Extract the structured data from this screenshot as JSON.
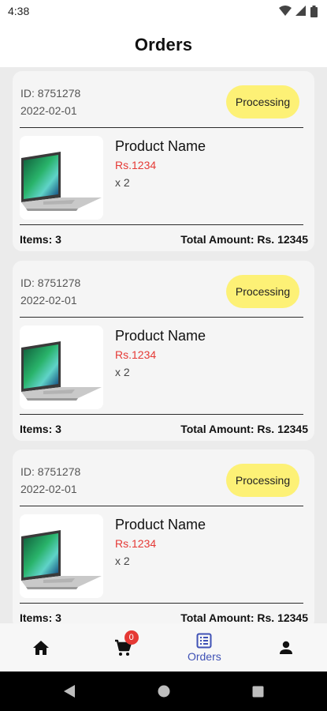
{
  "status_bar": {
    "time": "4:38"
  },
  "header": {
    "title": "Orders"
  },
  "orders": [
    {
      "id_text": "ID: 8751278",
      "date": "2022-02-01",
      "status": "Processing",
      "product_name": "Product Name",
      "price": "Rs.1234",
      "quantity": "x 2",
      "items_count": "Items: 3",
      "total": "Total Amount: Rs. 12345"
    },
    {
      "id_text": "ID: 8751278",
      "date": "2022-02-01",
      "status": "Processing",
      "product_name": "Product Name",
      "price": "Rs.1234",
      "quantity": "x 2",
      "items_count": "Items: 3",
      "total": "Total Amount: Rs. 12345"
    },
    {
      "id_text": "ID: 8751278",
      "date": "2022-02-01",
      "status": "Processing",
      "product_name": "Product Name",
      "price": "Rs.1234",
      "quantity": "x 2",
      "items_count": "Items: 3",
      "total": "Total Amount: Rs. 12345"
    }
  ],
  "bottom_nav": {
    "cart_badge": "0",
    "orders_label": "Orders",
    "items": [
      {
        "icon": "home-icon"
      },
      {
        "icon": "cart-icon"
      },
      {
        "icon": "orders-list-icon"
      },
      {
        "icon": "profile-icon"
      }
    ]
  },
  "colors": {
    "status_pill": "#fdf176",
    "price": "#e53935",
    "active_nav": "#3f51b5",
    "badge": "#e53935"
  }
}
